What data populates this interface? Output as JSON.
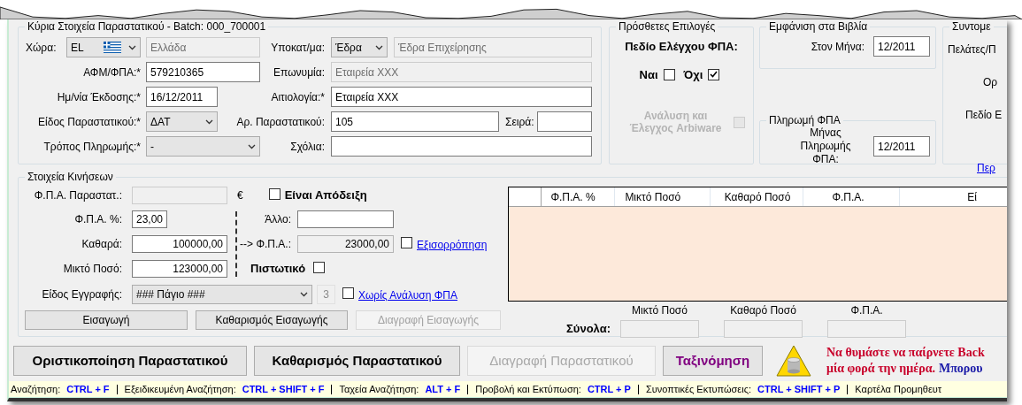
{
  "main_details": {
    "title": "Κύρια Στοιχεία Παραστατικού - Batch: 000_700001",
    "country": {
      "label": "Χώρα:",
      "code": "EL",
      "name": "Ελλάδα",
      "name_disabled": true
    },
    "branch": {
      "label": "Υποκατ/μα:",
      "value": "Έδρα",
      "name": "Έδρα Επιχείρησης",
      "name_disabled": true
    },
    "vat_number": {
      "label": "ΑΦΜ/ΦΠΑ:*",
      "value": "579210365",
      "disabled": false
    },
    "company_name": {
      "label": "Επωνυμία:",
      "value": "Εταιρεία XXX",
      "disabled": true
    },
    "issue_date": {
      "label": "Ημ/νία Έκδοσης:*",
      "value": "16/12/2011",
      "disabled": false
    },
    "reason": {
      "label": "Αιτιολογία:*",
      "value": "Εταιρεία XXX",
      "disabled": false
    },
    "document_type": {
      "label": "Είδος Παραστατικού:*",
      "value": "ΔΑΤ"
    },
    "document_number": {
      "label": "Αρ. Παραστατικού:",
      "value": "105",
      "disabled": false
    },
    "series": {
      "label": "Σειρά:",
      "disabled": false
    },
    "payment_method": {
      "label": "Τρόπος Πληρωμής:*",
      "value": "-"
    },
    "comments": {
      "label": "Σχόλια:",
      "disabled": false
    }
  },
  "extra_options": {
    "title": "Πρόσθετες Επιλογές",
    "vat_check_label": "Πεδίο Ελέγχου ΦΠΑ:",
    "options": [
      {
        "label": "Ναι",
        "checked": false
      },
      {
        "label": "Όχι",
        "checked": true
      }
    ],
    "arbiware": {
      "label": "Ανάλυση και Έλεγχος Arbiware",
      "checked": false,
      "disabled": true
    }
  },
  "books": {
    "title": "Εμφάνιση στα Βιβλία",
    "label": "Στον Μήνα:",
    "value": "12/2011"
  },
  "vat_payment": {
    "title": "Πληρωμή ΦΠΑ",
    "label": "Μήνας Πληρωμής ΦΠΑ:",
    "value": "12/2011"
  },
  "shortcuts_panel": {
    "title": "Συντομε",
    "lines": [
      "Πελάτες/Π",
      "Ορ",
      "Πεδίο Ε"
    ],
    "link": "Περ"
  },
  "movements": {
    "title": "Στοιχεία Κινήσεων",
    "doc_vat": {
      "label": "Φ.Π.Α. Παραστατ.:",
      "disabled": true
    },
    "currency": "€",
    "is_receipt": {
      "label": "Είναι Απόδειξη",
      "checked": false
    },
    "vat_percent": {
      "label": "Φ.Π.Α. %:",
      "value": "23,00",
      "disabled": false
    },
    "other": {
      "label": "Άλλο:",
      "disabled": false
    },
    "net": {
      "label": "Καθαρά:",
      "value": "100000,00",
      "disabled": false
    },
    "vat_amount": {
      "label": "--> Φ.Π.Α.:",
      "value": "23000,00",
      "readonly": true
    },
    "balancing": {
      "label": "Εξισορρόπηση",
      "checked": false
    },
    "gross": {
      "label": "Μικτό Ποσό:",
      "value": "123000,00",
      "disabled": false
    },
    "credit": {
      "label": "Πιστωτικό",
      "checked": false
    },
    "entry_type": {
      "label": "Είδος Εγγραφής:",
      "value": "### Πάγιο ###",
      "count": "3"
    },
    "no_vat_analysis": {
      "label": "Χωρίς Ανάλυση ΦΠΑ",
      "checked": false
    },
    "buttons": [
      {
        "label": "Εισαγωγή",
        "disabled": false
      },
      {
        "label": "Καθαρισμός Εισαγωγής",
        "disabled": false
      },
      {
        "label": "Διαγραφή Εισαγωγής",
        "disabled": true
      }
    ]
  },
  "table": {
    "columns": [
      "Φ.Π.Α. %",
      "Μικτό Ποσό",
      "Καθαρό Ποσό",
      "Φ.Π.Α.",
      "Εί"
    ]
  },
  "totals": {
    "label": "Σύνολα:",
    "columns": [
      "Μικτό Ποσό",
      "Καθαρό Ποσό",
      "Φ.Π.Α."
    ]
  },
  "actions": [
    {
      "label": "Οριστικοποίηση Παραστατικού",
      "kind": "normal"
    },
    {
      "label": "Καθαρισμός Παραστατικού",
      "kind": "normal"
    },
    {
      "label": "Διαγραφή Παραστατικού",
      "kind": "disabled"
    },
    {
      "label": "Ταξινόμηση",
      "kind": "accent"
    }
  ],
  "reminder": {
    "line1": "Να θυμάστε να παίρνετε Back",
    "line2": "μία φορά την ημέρα.",
    "link": "Μπορου"
  },
  "status_bar": [
    {
      "label": "Αναζήτηση:",
      "keys": "CTRL + F"
    },
    {
      "label": "Εξειδικευμένη Αναζήτηση:",
      "keys": "CTRL + SHIFT + F"
    },
    {
      "label": "Ταχεία Αναζήτηση:",
      "keys": "ALT + F"
    },
    {
      "label": "Προβολή και Εκτύπωση:",
      "keys": "CTRL + P"
    },
    {
      "label": "Συνοπτικές Εκτυπώσεις:",
      "keys": "CTRL + SHIFT + P"
    },
    {
      "label": "Καρτέλα Προμηθευτ"
    }
  ]
}
